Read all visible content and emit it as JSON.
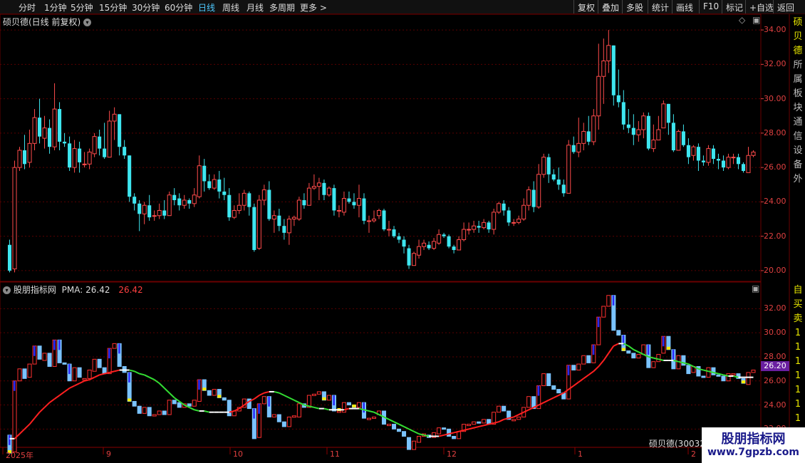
{
  "toolbar": {
    "left": [
      "分时",
      "1分钟",
      "5分钟",
      "15分钟",
      "30分钟",
      "60分钟",
      "日线",
      "周线",
      "月线",
      "多周期",
      "更多 >"
    ],
    "active": "日线",
    "right": [
      "复权",
      "叠加",
      "多股",
      "统计",
      "画线",
      "F10",
      "标记",
      "+自选",
      "返回"
    ]
  },
  "main_panel": {
    "title": "硕贝德(日线 前复权)",
    "y_ticks": [
      "34.00",
      "32.00",
      "30.00",
      "28.00",
      "26.00",
      "24.00",
      "22.00",
      "20.00"
    ]
  },
  "indicator_panel": {
    "title": "股朋指标网",
    "pma_label": "PMA: 26.42",
    "pma_value": "26.42",
    "y_ticks": [
      "32.00",
      "30.00",
      "28.00",
      "26.00",
      "24.00",
      "22.00"
    ],
    "current_price": "26.20",
    "stock_label": "硕贝德(30032"
  },
  "x_axis": {
    "labels": [
      {
        "text": "2025年",
        "x": 8
      },
      {
        "text": "9",
        "x": 149
      },
      {
        "text": "10",
        "x": 327
      },
      {
        "text": "11",
        "x": 463
      },
      {
        "text": "12",
        "x": 627
      },
      {
        "text": "1",
        "x": 811
      },
      {
        "text": "2",
        "x": 970
      }
    ]
  },
  "right_strip": {
    "top_chars": [
      "硕",
      "贝",
      "德",
      "所",
      "属",
      "板",
      "块",
      "通",
      "信",
      "设",
      "备",
      "外"
    ],
    "bottom_chars": [
      "自",
      "买",
      "卖",
      "1",
      "1",
      "1",
      "1",
      "1",
      "1",
      "1"
    ]
  },
  "watermark": {
    "title": "股朋指标网",
    "url": "www.7gpzb.com"
  },
  "colors": {
    "up": "#ff4b4b",
    "down": "#3ee6f0",
    "pma_up": "#ff2020",
    "pma_down": "#33dd33",
    "bg": "#000000"
  },
  "chart_data": {
    "type": "candlestick",
    "ylim": [
      19.5,
      34.5
    ],
    "candles": [
      [
        21.5,
        20.0,
        21.8,
        19.9
      ],
      [
        20.1,
        26.0,
        26.4,
        19.9
      ],
      [
        26.0,
        27.0,
        27.2,
        25.8
      ],
      [
        27.0,
        26.2,
        27.9,
        25.9
      ],
      [
        26.3,
        27.4,
        28.2,
        26.0
      ],
      [
        27.4,
        28.9,
        29.4,
        27.0
      ],
      [
        28.9,
        27.8,
        30.0,
        27.4
      ],
      [
        27.7,
        28.3,
        29.0,
        27.1
      ],
      [
        28.3,
        27.2,
        28.8,
        26.8
      ],
      [
        27.2,
        29.4,
        30.9,
        27.0
      ],
      [
        29.4,
        27.5,
        29.8,
        27.0
      ],
      [
        27.5,
        27.4,
        28.0,
        27.2
      ],
      [
        27.4,
        26.0,
        27.8,
        25.8
      ],
      [
        26.0,
        27.1,
        27.6,
        25.7
      ],
      [
        27.1,
        26.3,
        27.5,
        25.7
      ],
      [
        26.2,
        26.2,
        26.9,
        26.0
      ],
      [
        26.2,
        26.9,
        27.1,
        25.9
      ],
      [
        26.8,
        27.8,
        28.0,
        26.6
      ],
      [
        27.8,
        27.1,
        28.2,
        26.7
      ],
      [
        27.1,
        26.6,
        28.6,
        26.5
      ],
      [
        26.6,
        28.7,
        29.3,
        26.6
      ],
      [
        28.7,
        29.1,
        29.5,
        27.6
      ],
      [
        29.1,
        27.2,
        29.1,
        26.7
      ],
      [
        27.2,
        26.7,
        27.6,
        26.5
      ],
      [
        26.7,
        24.3,
        26.7,
        24.0
      ],
      [
        24.3,
        23.9,
        24.5,
        23.5
      ],
      [
        23.9,
        23.3,
        24.1,
        22.3
      ],
      [
        23.3,
        23.8,
        24.0,
        22.7
      ],
      [
        23.8,
        23.1,
        24.4,
        22.9
      ],
      [
        23.2,
        23.2,
        23.5,
        22.9
      ],
      [
        23.2,
        23.5,
        23.9,
        23.0
      ],
      [
        23.5,
        23.2,
        24.1,
        23.0
      ],
      [
        23.2,
        24.4,
        24.6,
        23.2
      ],
      [
        24.4,
        24.1,
        24.8,
        23.8
      ],
      [
        24.2,
        23.8,
        24.5,
        23.5
      ],
      [
        23.8,
        24.1,
        24.4,
        23.6
      ],
      [
        24.1,
        23.9,
        24.2,
        23.6
      ],
      [
        23.9,
        24.4,
        24.8,
        23.7
      ],
      [
        24.3,
        26.1,
        26.7,
        24.2
      ],
      [
        26.1,
        25.2,
        26.5,
        24.6
      ],
      [
        25.2,
        24.8,
        25.6,
        24.7
      ],
      [
        24.8,
        25.3,
        25.6,
        24.7
      ],
      [
        25.3,
        24.6,
        25.8,
        24.2
      ],
      [
        24.6,
        24.4,
        25.4,
        24.1
      ],
      [
        24.4,
        23.1,
        24.8,
        22.9
      ],
      [
        23.1,
        23.5,
        23.8,
        23.0
      ],
      [
        23.5,
        23.8,
        24.5,
        23.3
      ],
      [
        23.8,
        24.5,
        24.7,
        23.5
      ],
      [
        24.5,
        23.7,
        24.6,
        23.2
      ],
      [
        23.7,
        21.2,
        23.9,
        21.1
      ],
      [
        21.3,
        24.1,
        24.4,
        21.2
      ],
      [
        24.1,
        24.7,
        25.0,
        23.8
      ],
      [
        24.7,
        23.0,
        25.2,
        22.9
      ],
      [
        23.0,
        23.2,
        23.5,
        22.2
      ],
      [
        23.2,
        22.6,
        23.6,
        22.3
      ],
      [
        22.6,
        22.2,
        23.0,
        21.8
      ],
      [
        22.2,
        23.0,
        23.2,
        21.5
      ],
      [
        23.0,
        23.1,
        23.2,
        22.6
      ],
      [
        23.0,
        24.1,
        24.3,
        22.9
      ],
      [
        24.1,
        23.8,
        24.5,
        23.6
      ],
      [
        23.8,
        24.8,
        25.1,
        23.8
      ],
      [
        24.8,
        24.9,
        25.6,
        24.7
      ],
      [
        24.9,
        25.1,
        25.4,
        24.1
      ],
      [
        25.1,
        24.4,
        25.3,
        24.1
      ],
      [
        24.4,
        24.8,
        24.9,
        24.3
      ],
      [
        24.8,
        23.5,
        25.0,
        23.2
      ],
      [
        23.5,
        23.5,
        23.8,
        23.1
      ],
      [
        23.4,
        24.2,
        24.6,
        23.2
      ],
      [
        24.2,
        24.0,
        24.6,
        23.9
      ],
      [
        24.0,
        23.8,
        24.5,
        23.6
      ],
      [
        23.8,
        24.2,
        25.0,
        23.1
      ],
      [
        24.2,
        22.9,
        24.5,
        22.7
      ],
      [
        22.9,
        22.9,
        23.2,
        22.2
      ],
      [
        22.9,
        23.0,
        23.5,
        22.8
      ],
      [
        23.2,
        23.5,
        23.6,
        23.0
      ],
      [
        23.5,
        22.4,
        23.6,
        22.3
      ],
      [
        22.4,
        22.4,
        22.9,
        22.0
      ],
      [
        22.4,
        22.0,
        22.6,
        21.9
      ],
      [
        22.0,
        21.8,
        22.2,
        21.6
      ],
      [
        21.8,
        21.4,
        22.0,
        21.0
      ],
      [
        21.3,
        20.3,
        21.5,
        20.1
      ],
      [
        20.3,
        21.0,
        21.1,
        20.3
      ],
      [
        20.9,
        21.4,
        21.8,
        20.7
      ],
      [
        21.4,
        21.6,
        21.8,
        21.2
      ],
      [
        21.5,
        21.3,
        21.7,
        21.2
      ],
      [
        21.3,
        21.7,
        21.9,
        21.2
      ],
      [
        21.6,
        22.1,
        22.4,
        21.5
      ],
      [
        22.1,
        22.0,
        22.2,
        21.9
      ],
      [
        22.0,
        21.4,
        22.1,
        21.3
      ],
      [
        21.4,
        21.2,
        21.5,
        21.0
      ],
      [
        21.2,
        21.8,
        22.0,
        21.2
      ],
      [
        21.8,
        22.4,
        22.8,
        21.7
      ],
      [
        22.4,
        22.4,
        22.8,
        22.1
      ],
      [
        22.4,
        22.6,
        22.9,
        22.2
      ],
      [
        22.6,
        22.5,
        22.9,
        22.2
      ],
      [
        22.5,
        22.8,
        23.0,
        22.4
      ],
      [
        22.8,
        22.4,
        22.9,
        22.2
      ],
      [
        22.4,
        23.4,
        23.6,
        22.1
      ],
      [
        23.4,
        23.9,
        24.0,
        23.3
      ],
      [
        23.9,
        23.5,
        24.1,
        23.2
      ],
      [
        23.5,
        22.8,
        23.7,
        22.6
      ],
      [
        22.8,
        22.8,
        23.0,
        22.6
      ],
      [
        22.8,
        23.0,
        23.2,
        22.7
      ],
      [
        23.0,
        23.8,
        24.2,
        22.9
      ],
      [
        23.8,
        24.7,
        24.9,
        23.5
      ],
      [
        24.7,
        23.7,
        25.2,
        23.4
      ],
      [
        23.7,
        25.6,
        26.2,
        23.6
      ],
      [
        25.6,
        26.6,
        26.8,
        25.4
      ],
      [
        26.6,
        25.6,
        26.8,
        25.1
      ],
      [
        25.6,
        25.3,
        25.9,
        25.2
      ],
      [
        25.3,
        25.0,
        26.0,
        24.7
      ],
      [
        25.0,
        24.5,
        25.3,
        24.3
      ],
      [
        24.5,
        27.3,
        27.6,
        24.5
      ],
      [
        27.3,
        26.9,
        27.8,
        26.8
      ],
      [
        26.9,
        27.4,
        28.9,
        26.6
      ],
      [
        27.4,
        28.1,
        28.6,
        27.0
      ],
      [
        28.1,
        27.5,
        29.0,
        27.3
      ],
      [
        27.5,
        29.0,
        29.4,
        27.3
      ],
      [
        29.0,
        31.3,
        33.2,
        28.2
      ],
      [
        31.3,
        32.2,
        33.5,
        29.7
      ],
      [
        32.2,
        33.1,
        34.0,
        31.5
      ],
      [
        33.1,
        30.2,
        33.1,
        29.6
      ],
      [
        30.2,
        29.8,
        31.7,
        29.5
      ],
      [
        29.8,
        28.5,
        30.5,
        28.2
      ],
      [
        28.5,
        28.3,
        29.4,
        28.0
      ],
      [
        28.3,
        27.9,
        29.1,
        27.3
      ],
      [
        27.9,
        28.2,
        28.7,
        27.5
      ],
      [
        28.2,
        29.0,
        29.2,
        27.7
      ],
      [
        29.0,
        27.1,
        29.2,
        27.0
      ],
      [
        27.1,
        27.6,
        28.5,
        26.9
      ],
      [
        27.6,
        28.2,
        29.0,
        27.7
      ],
      [
        28.3,
        29.7,
        29.9,
        28.5
      ],
      [
        29.7,
        28.6,
        29.7,
        27.9
      ],
      [
        28.6,
        27.0,
        29.1,
        26.9
      ],
      [
        27.0,
        28.1,
        28.2,
        27.0
      ],
      [
        28.1,
        27.3,
        28.5,
        27.2
      ],
      [
        27.3,
        26.6,
        27.7,
        26.2
      ],
      [
        26.7,
        27.2,
        27.3,
        26.4
      ],
      [
        27.2,
        26.4,
        27.4,
        25.8
      ],
      [
        26.4,
        26.3,
        26.7,
        26.1
      ],
      [
        26.3,
        27.1,
        27.3,
        26.1
      ],
      [
        27.1,
        26.5,
        27.3,
        26.2
      ],
      [
        26.5,
        26.4,
        26.8,
        25.9
      ],
      [
        26.4,
        26.0,
        26.7,
        25.8
      ],
      [
        26.0,
        26.6,
        26.8,
        25.9
      ],
      [
        26.6,
        26.6,
        26.8,
        26.2
      ],
      [
        26.6,
        26.2,
        26.8,
        25.9
      ],
      [
        26.2,
        25.8,
        26.3,
        25.7
      ],
      [
        25.7,
        26.7,
        27.2,
        25.7
      ],
      [
        26.7,
        26.9,
        27.0,
        26.6
      ]
    ],
    "pma": [
      21.2,
      21.2,
      21.6,
      22.0,
      22.4,
      22.9,
      23.4,
      23.8,
      24.2,
      24.5,
      24.8,
      25.1,
      25.4,
      25.6,
      25.8,
      26.0,
      26.1,
      26.3,
      26.5,
      26.6,
      26.7,
      26.8,
      26.9,
      26.9,
      26.9,
      26.8,
      26.6,
      26.5,
      26.3,
      26.1,
      25.8,
      25.4,
      25.0,
      24.6,
      24.3,
      24.0,
      23.8,
      23.6,
      23.5,
      23.5,
      23.4,
      23.4,
      23.4,
      23.4,
      23.4,
      23.5,
      23.7,
      24.0,
      24.3,
      24.5,
      24.8,
      25.0,
      25.1,
      25.1,
      25.0,
      24.8,
      24.6,
      24.4,
      24.2,
      24.0,
      23.9,
      23.8,
      23.7,
      23.7,
      23.6,
      23.6,
      23.6,
      23.6,
      23.7,
      23.7,
      23.7,
      23.6,
      23.5,
      23.4,
      23.2,
      23.0,
      22.8,
      22.6,
      22.4,
      22.2,
      22.0,
      21.8,
      21.6,
      21.5,
      21.4,
      21.4,
      21.4,
      21.5,
      21.6,
      21.7,
      21.8,
      21.9,
      22.0,
      22.1,
      22.2,
      22.3,
      22.4,
      22.5,
      22.6,
      22.8,
      22.9,
      23.0,
      23.2,
      23.4,
      23.6,
      23.8,
      24.0,
      24.2,
      24.4,
      24.6,
      24.8,
      25.0,
      25.3,
      25.6,
      25.9,
      26.2,
      26.5,
      26.8,
      27.2,
      27.7,
      28.3,
      28.9,
      29.1,
      29.1,
      28.9,
      28.6,
      28.4,
      28.2,
      28.0,
      27.9,
      27.8,
      27.7,
      27.7,
      27.7,
      27.6,
      27.5,
      27.4,
      27.2,
      27.0,
      26.9,
      26.8,
      26.7,
      26.6,
      26.5,
      26.4,
      26.4,
      26.3,
      26.3,
      26.3,
      26.3
    ]
  }
}
